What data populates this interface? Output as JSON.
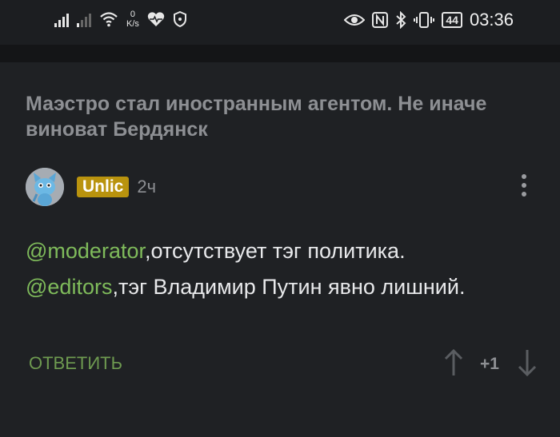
{
  "status_bar": {
    "net_speed_value": "0",
    "net_speed_unit": "K/s",
    "battery": "44",
    "time": "03:36"
  },
  "post": {
    "title": "Маэстро стал иностранным агентом. Не иначе виноват Бердянск"
  },
  "comment": {
    "username": "Unlic",
    "time_ago": "2ч",
    "mention1": "@moderator",
    "text1": ",отсутствует тэг политика.",
    "mention2": "@editors",
    "text2": ",тэг Владимир Путин явно лишний.",
    "reply_label": "ОТВЕТИТЬ",
    "score": "+1"
  },
  "colors": {
    "background": "#1f2124",
    "mention": "#7fbb5b",
    "username_badge": "#b9930e",
    "reply": "#6e9a50"
  },
  "icons": [
    "signal-icon",
    "wifi-icon",
    "heart-monitor-icon",
    "shield-icon",
    "eye-icon",
    "nfc-icon",
    "bluetooth-icon",
    "vibrate-icon",
    "battery-icon",
    "upvote-icon",
    "downvote-icon",
    "more-icon"
  ]
}
